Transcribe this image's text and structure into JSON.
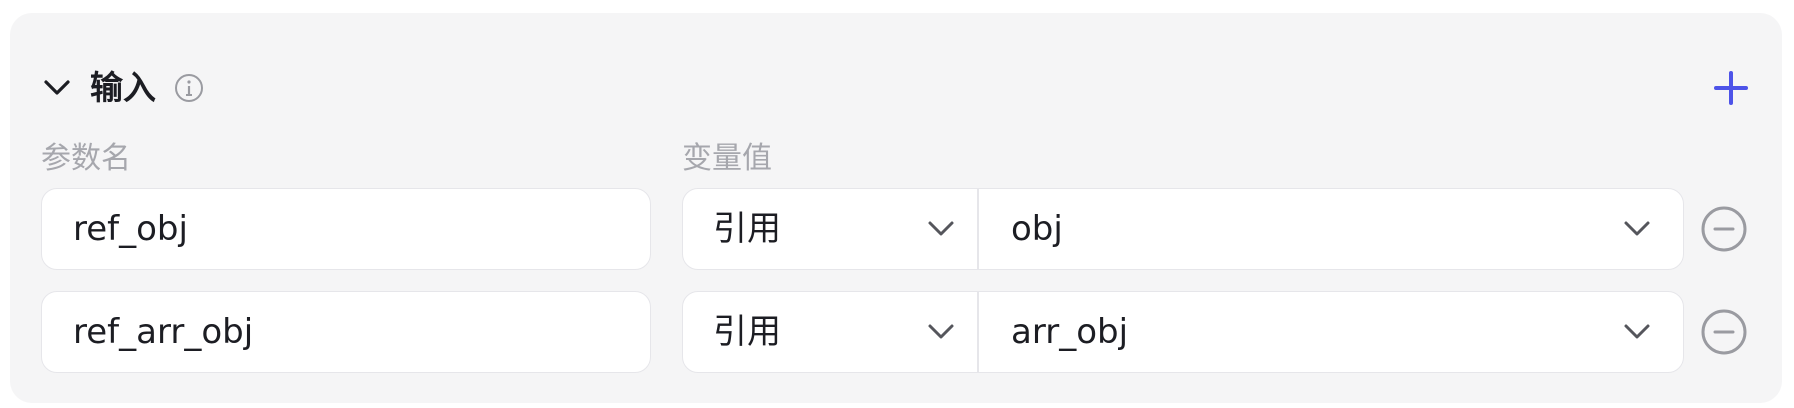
{
  "section": {
    "title": "输入",
    "collapse_icon": "chevron-down-icon",
    "info_icon": "info-circle-icon",
    "add_icon": "plus-icon",
    "accent_color": "#4d53e8"
  },
  "columns": {
    "name_label": "参数名",
    "value_label": "变量值"
  },
  "rows": [
    {
      "name": "ref_obj",
      "type": "引用",
      "value": "obj"
    },
    {
      "name": "ref_arr_obj",
      "type": "引用",
      "value": "arr_obj"
    }
  ],
  "row_actions": {
    "remove_icon": "minus-circle-icon"
  }
}
